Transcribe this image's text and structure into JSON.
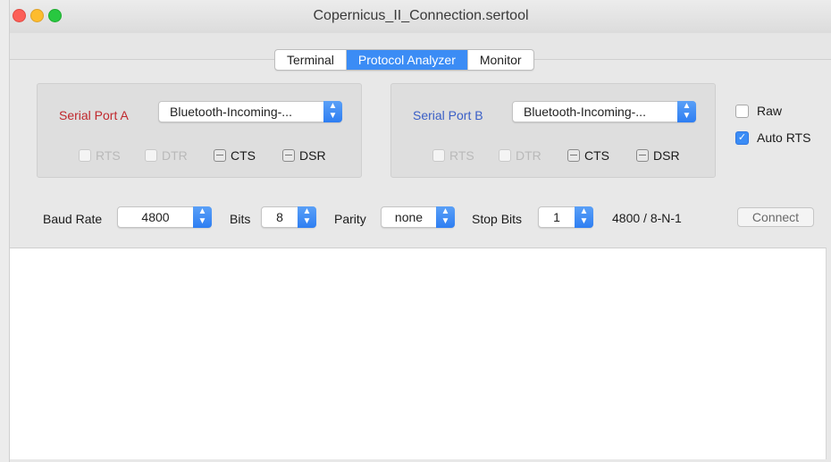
{
  "window": {
    "title": "Copernicus_II_Connection.sertool"
  },
  "tabs": [
    {
      "label": "Terminal",
      "active": false
    },
    {
      "label": "Protocol Analyzer",
      "active": true
    },
    {
      "label": "Monitor",
      "active": false
    }
  ],
  "port_a": {
    "label": "Serial Port A",
    "selected": "Bluetooth-Incoming-...",
    "signals": {
      "rts": "RTS",
      "dtr": "DTR",
      "cts": "CTS",
      "dsr": "DSR"
    }
  },
  "port_b": {
    "label": "Serial Port B",
    "selected": "Bluetooth-Incoming-...",
    "signals": {
      "rts": "RTS",
      "dtr": "DTR",
      "cts": "CTS",
      "dsr": "DSR"
    }
  },
  "options": {
    "raw": {
      "label": "Raw",
      "checked": false
    },
    "auto_rts": {
      "label": "Auto RTS",
      "checked": true
    }
  },
  "settings": {
    "baud_label": "Baud Rate",
    "baud_value": "4800",
    "bits_label": "Bits",
    "bits_value": "8",
    "parity_label": "Parity",
    "parity_value": "none",
    "stop_label": "Stop Bits",
    "stop_value": "1",
    "summary": "4800 / 8-N-1",
    "connect_label": "Connect"
  },
  "colors": {
    "accent": "#3b8cf5",
    "port_a": "#c0282d",
    "port_b": "#3a5fc6"
  },
  "icons": {
    "stepper": "up-down-chevron-icon",
    "check": "checkmark-icon"
  }
}
